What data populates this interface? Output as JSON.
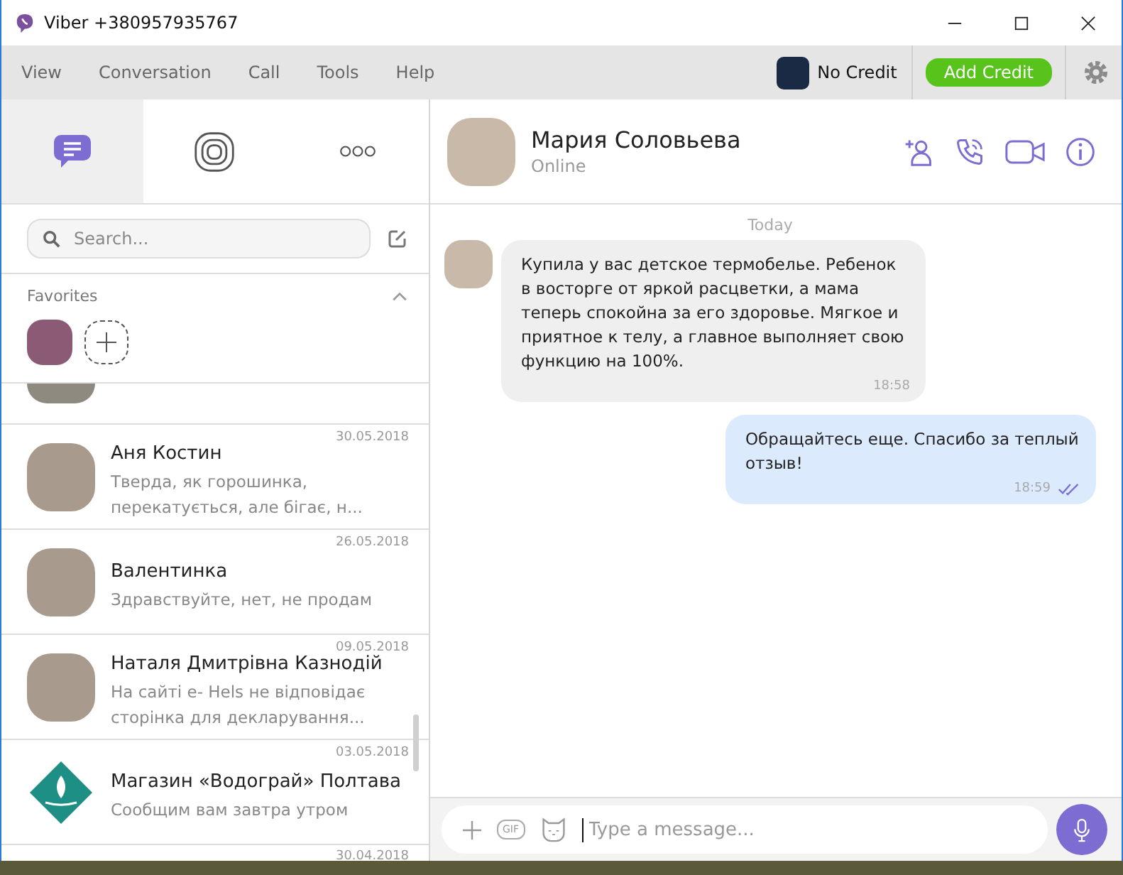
{
  "window": {
    "title": "Viber +380957935767"
  },
  "menu": [
    "View",
    "Conversation",
    "Call",
    "Tools",
    "Help"
  ],
  "account": {
    "credit": "No Credit",
    "add_credit": "Add Credit"
  },
  "tabs": [
    {
      "kind": "chats",
      "selected": true
    },
    {
      "kind": "stories",
      "selected": false
    },
    {
      "kind": "more",
      "selected": false
    }
  ],
  "search": {
    "placeholder": "Search..."
  },
  "favorites": {
    "title": "Favorites",
    "expanded": true
  },
  "contacts": [
    {
      "kind": "photo",
      "name": "Аня Костин",
      "date": "30.05.2018",
      "preview": [
        "Тверда, як горошинка,",
        "перекатується, але бігає, н..."
      ]
    },
    {
      "kind": "photo",
      "name": "Валентинка",
      "date": "26.05.2018",
      "preview": [
        "Здравствуйте, нет, не продам"
      ]
    },
    {
      "kind": "photo",
      "name": "Наталя Дмитрівна Казнодій",
      "date": "09.05.2018",
      "preview": [
        "На сайті е- Hels не відповідає",
        "сторінка для декларування..."
      ]
    },
    {
      "kind": "logo",
      "name": "Магазин «Водограй»  Полтава",
      "date": "03.05.2018",
      "preview": [
        "Сообщим вам завтра утром"
      ]
    }
  ],
  "partial_contact": {
    "date": "30.04.2018"
  },
  "chat": {
    "name": "Мария Соловьева",
    "status": "Online",
    "day": "Today"
  },
  "messages": [
    {
      "kind": "incoming",
      "text": "Купила у вас детское термобелье. Ребенок в восторге от яркой расцветки, а мама теперь спокойна за его здоровье. Мягкое и приятное к телу, а главное выполняет свою функцию на 100%.",
      "time": "18:58"
    },
    {
      "kind": "outgoing",
      "text": "Обращайтесь еще. Спасибо за теплый отзыв!",
      "time": "18:59"
    }
  ],
  "composer": {
    "gif": "GIF",
    "placeholder": "Type a message..."
  }
}
